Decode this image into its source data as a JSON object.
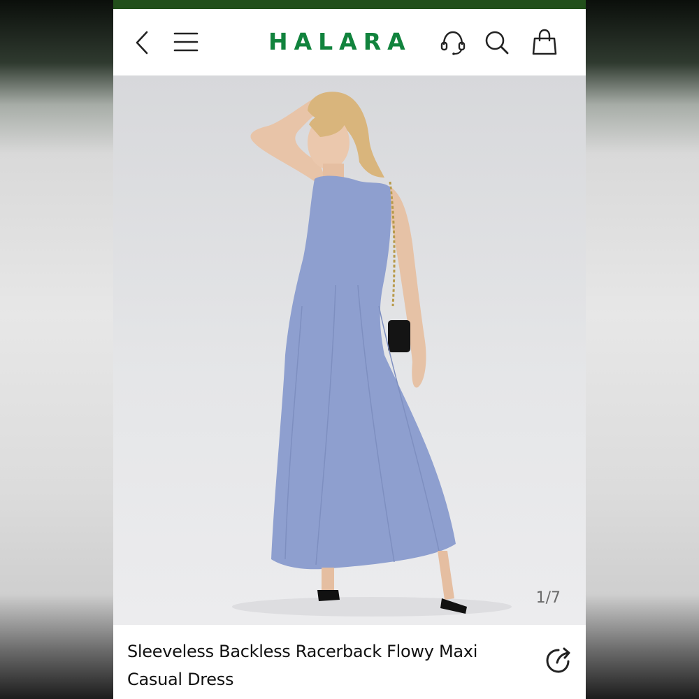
{
  "brand": {
    "logo_text": "HALARA",
    "color": "#11833d",
    "top_strip_color": "#224f1b"
  },
  "header": {
    "icons": [
      "back-arrow-icon",
      "menu-icon",
      "customer-service-headset-icon",
      "search-icon",
      "shopping-bag-icon"
    ]
  },
  "gallery": {
    "counter": "1/7",
    "dress_color": "#8e9fcf",
    "background_color": "#e2e3e5"
  },
  "product": {
    "title": "Sleeveless Backless Racerback Flowy Maxi Casual Dress",
    "share_icon": "share-icon"
  }
}
